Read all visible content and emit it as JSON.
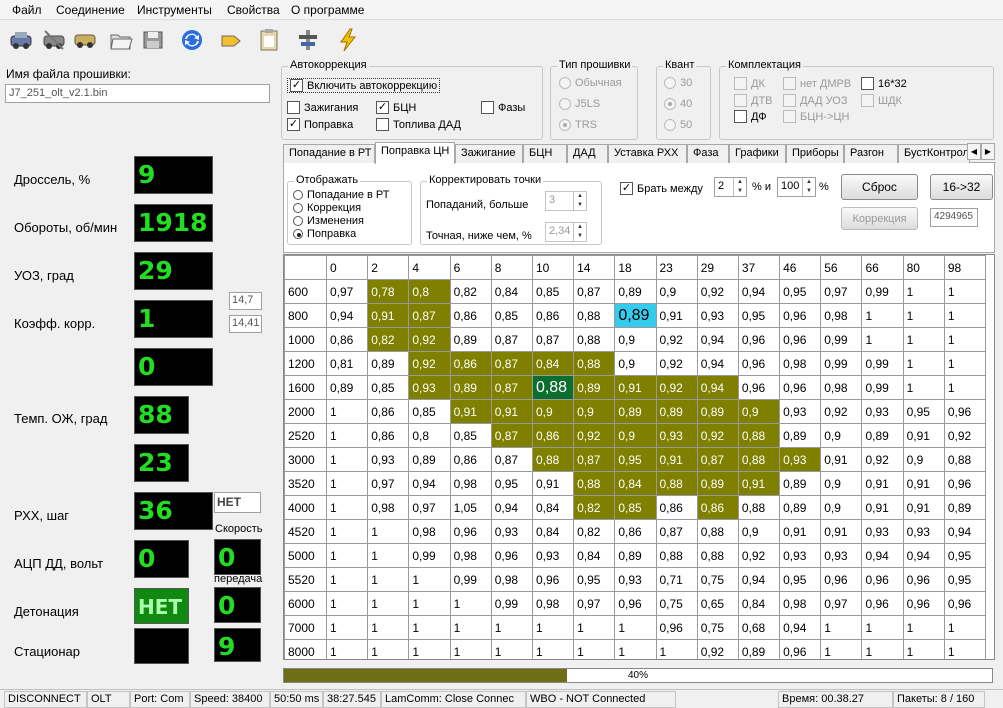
{
  "menu": [
    "Файл",
    "Соединение",
    "Инструменты",
    "Свойства",
    "О программе"
  ],
  "toolbar": [
    "connect-icon",
    "disconnect-icon",
    "read-icon",
    "open-file-icon",
    "save-file-icon",
    "refresh-icon",
    "erase-icon",
    "clipboard-icon",
    "settings-icon",
    "flash-icon"
  ],
  "left": {
    "file_label": "Имя файла прошивки:",
    "file_value": "J7_251_olt_v2.1.bin",
    "throttle_label": "Дроссель, %",
    "throttle": "9",
    "rpm_label": "Обороты, об/мин",
    "rpm": "1918",
    "uoz_label": "УОЗ, град",
    "uoz": "29",
    "kcorr_label": "Коэфф. корр.",
    "kcorr": "1",
    "afr1": "14,7",
    "afr2": "14,41",
    "unnamed": "0",
    "temp_label": "Темп. ОЖ, град",
    "temp": "88",
    "air": "23",
    "rxx_label": "РХХ, шаг",
    "rxx": "36",
    "rxx_status": "НЕТ",
    "speed_label": "Скорость",
    "speed": "0",
    "adc_label": "АЦП ДД, вольт",
    "adc": "0",
    "gear_label": "передача",
    "gear": "0",
    "knock_label": "Детонация",
    "knock": "НЕТ",
    "stat_label": "Стационар",
    "stat": "",
    "stat_value": "9"
  },
  "autocorr": {
    "title": "Автокоррекция",
    "enable": "Включить автокоррекцию",
    "ign": "Зажигания",
    "bcn": "БЦН",
    "phases": "Фазы",
    "fix": "Поправка",
    "fuel_dad": "Топлива ДАД"
  },
  "fw_type": {
    "title": "Тип прошивки",
    "options": [
      "Обычная",
      "J5LS",
      "TRS"
    ],
    "selected": 2
  },
  "kvant": {
    "title": "Квант",
    "options": [
      "30",
      "40",
      "50"
    ],
    "selected": 1
  },
  "kompl": {
    "title": "Комплектация",
    "items": [
      {
        "label": "ДК",
        "checked": false
      },
      {
        "label": "нет ДМРВ",
        "checked": false
      },
      {
        "label": "16*32",
        "checked": false
      },
      {
        "label": "ДТВ",
        "checked": false
      },
      {
        "label": "ДАД УОЗ",
        "checked": false
      },
      {
        "label": "ШДК",
        "checked": false
      },
      {
        "label": "ДФ",
        "checked": false
      },
      {
        "label": "БЦН->ЦН",
        "checked": false
      }
    ]
  },
  "tabs": [
    "Попадание в РТ",
    "Поправка ЦН",
    "Зажигание",
    "БЦН",
    "ДАД",
    "Уставка РХХ",
    "Фаза",
    "Графики",
    "Приборы",
    "Разгон",
    "БустКонтрол"
  ],
  "active_tab": 1,
  "display": {
    "title": "Отображать",
    "options": [
      "Попадание в РТ",
      "Коррекция",
      "Изменения",
      "Поправка"
    ],
    "selected": 3
  },
  "correct": {
    "title": "Корректировать точки",
    "hits_label": "Попаданий, больше",
    "hits_value": "3",
    "acc_label": "Точная, ниже чем, %",
    "acc_value": "2,34"
  },
  "between": {
    "label": "Брать между",
    "from": "2",
    "and_label": "% и",
    "to": "100",
    "pct": "%"
  },
  "buttons": {
    "reset": "Сброс",
    "b1632": "16->32",
    "correction": "Коррекция",
    "counter": "4294965"
  },
  "grid": {
    "cols": [
      "0",
      "2",
      "4",
      "6",
      "8",
      "10",
      "14",
      "18",
      "23",
      "29",
      "37",
      "46",
      "56",
      "66",
      "80",
      "98"
    ],
    "rows": [
      "600",
      "800",
      "1000",
      "1200",
      "1600",
      "2000",
      "2520",
      "3000",
      "3520",
      "4000",
      "4520",
      "5000",
      "5520",
      "6000",
      "7000",
      "8000"
    ],
    "values": [
      [
        "0,97",
        "0,78",
        "0,8",
        "0,82",
        "0,84",
        "0,85",
        "0,87",
        "0,89",
        "0,9",
        "0,92",
        "0,94",
        "0,95",
        "0,97",
        "0,99",
        "1",
        "1"
      ],
      [
        "0,94",
        "0,91",
        "0,87",
        "0,86",
        "0,85",
        "0,86",
        "0,88",
        "0,89",
        "0,91",
        "0,93",
        "0,95",
        "0,96",
        "0,98",
        "1",
        "1",
        "1"
      ],
      [
        "0,86",
        "0,82",
        "0,92",
        "0,89",
        "0,87",
        "0,87",
        "0,88",
        "0,9",
        "0,92",
        "0,94",
        "0,96",
        "0,96",
        "0,99",
        "1",
        "1",
        "1"
      ],
      [
        "0,81",
        "0,89",
        "0,92",
        "0,86",
        "0,87",
        "0,84",
        "0,88",
        "0,9",
        "0,92",
        "0,94",
        "0,96",
        "0,98",
        "0,99",
        "0,99",
        "1",
        "1"
      ],
      [
        "0,89",
        "0,85",
        "0,93",
        "0,89",
        "0,87",
        "0,88",
        "0,89",
        "0,91",
        "0,92",
        "0,94",
        "0,96",
        "0,96",
        "0,98",
        "0,99",
        "1",
        "1"
      ],
      [
        "1",
        "0,86",
        "0,85",
        "0,91",
        "0,91",
        "0,9",
        "0,9",
        "0,89",
        "0,89",
        "0,89",
        "0,9",
        "0,93",
        "0,92",
        "0,93",
        "0,95",
        "0,96"
      ],
      [
        "1",
        "0,86",
        "0,8",
        "0,85",
        "0,87",
        "0,86",
        "0,92",
        "0,9",
        "0,93",
        "0,92",
        "0,88",
        "0,89",
        "0,9",
        "0,89",
        "0,91",
        "0,92"
      ],
      [
        "1",
        "0,93",
        "0,89",
        "0,86",
        "0,87",
        "0,88",
        "0,87",
        "0,95",
        "0,91",
        "0,87",
        "0,88",
        "0,93",
        "0,91",
        "0,92",
        "0,9",
        "0,88"
      ],
      [
        "1",
        "0,97",
        "0,94",
        "0,98",
        "0,95",
        "0,91",
        "0,88",
        "0,84",
        "0,88",
        "0,89",
        "0,91",
        "0,89",
        "0,9",
        "0,91",
        "0,91",
        "0,96"
      ],
      [
        "1",
        "0,98",
        "0,97",
        "1,05",
        "0,94",
        "0,84",
        "0,82",
        "0,85",
        "0,86",
        "0,86",
        "0,88",
        "0,89",
        "0,9",
        "0,91",
        "0,91",
        "0,89"
      ],
      [
        "1",
        "1",
        "0,98",
        "0,96",
        "0,93",
        "0,84",
        "0,82",
        "0,86",
        "0,87",
        "0,88",
        "0,9",
        "0,91",
        "0,91",
        "0,93",
        "0,93",
        "0,94"
      ],
      [
        "1",
        "1",
        "0,99",
        "0,98",
        "0,96",
        "0,93",
        "0,84",
        "0,89",
        "0,88",
        "0,88",
        "0,92",
        "0,93",
        "0,93",
        "0,94",
        "0,94",
        "0,95"
      ],
      [
        "1",
        "1",
        "1",
        "0,99",
        "0,98",
        "0,96",
        "0,95",
        "0,93",
        "0,71",
        "0,75",
        "0,94",
        "0,95",
        "0,96",
        "0,96",
        "0,96",
        "0,95"
      ],
      [
        "1",
        "1",
        "1",
        "1",
        "0,99",
        "0,98",
        "0,97",
        "0,96",
        "0,75",
        "0,65",
        "0,84",
        "0,98",
        "0,97",
        "0,96",
        "0,96",
        "0,96"
      ],
      [
        "1",
        "1",
        "1",
        "1",
        "1",
        "1",
        "1",
        "1",
        "0,96",
        "0,75",
        "0,68",
        "0,94",
        "1",
        "1",
        "1",
        "1"
      ],
      [
        "1",
        "1",
        "1",
        "1",
        "1",
        "1",
        "1",
        "1",
        "1",
        "0,92",
        "0,89",
        "0,96",
        "1",
        "1",
        "1",
        "1"
      ]
    ],
    "highlight": [
      [
        0,
        1
      ],
      [
        0,
        2
      ],
      [
        1,
        1
      ],
      [
        1,
        2
      ],
      [
        2,
        1
      ],
      [
        2,
        2
      ],
      [
        3,
        2
      ],
      [
        3,
        3
      ],
      [
        3,
        4
      ],
      [
        3,
        5
      ],
      [
        3,
        6
      ],
      [
        4,
        2
      ],
      [
        4,
        3
      ],
      [
        4,
        4
      ],
      [
        4,
        6
      ],
      [
        4,
        7
      ],
      [
        4,
        8
      ],
      [
        4,
        9
      ],
      [
        5,
        3
      ],
      [
        5,
        4
      ],
      [
        5,
        5
      ],
      [
        5,
        6
      ],
      [
        5,
        7
      ],
      [
        5,
        8
      ],
      [
        5,
        9
      ],
      [
        5,
        10
      ],
      [
        6,
        4
      ],
      [
        6,
        5
      ],
      [
        6,
        6
      ],
      [
        6,
        7
      ],
      [
        6,
        8
      ],
      [
        6,
        9
      ],
      [
        6,
        10
      ],
      [
        6,
        16
      ],
      [
        7,
        5
      ],
      [
        7,
        6
      ],
      [
        7,
        7
      ],
      [
        7,
        8
      ],
      [
        7,
        9
      ],
      [
        7,
        10
      ],
      [
        7,
        11
      ],
      [
        7,
        16
      ],
      [
        8,
        6
      ],
      [
        8,
        7
      ],
      [
        8,
        8
      ],
      [
        8,
        9
      ],
      [
        8,
        10
      ],
      [
        8,
        16
      ],
      [
        9,
        6
      ],
      [
        9,
        7
      ],
      [
        9,
        9
      ]
    ],
    "current": [
      4,
      5
    ],
    "selected": [
      1,
      7
    ]
  },
  "progress": {
    "percent": 40,
    "label": "40%"
  },
  "status": [
    "DISCONNECT",
    "OLT",
    "Port: Com",
    "Speed: 38400",
    "50:50 ms",
    "38:27.545",
    "LamComm: Close Connec",
    "WBO - NOT Connected",
    "Время: 00.38.27",
    "Пакеты:  8 / 160"
  ]
}
